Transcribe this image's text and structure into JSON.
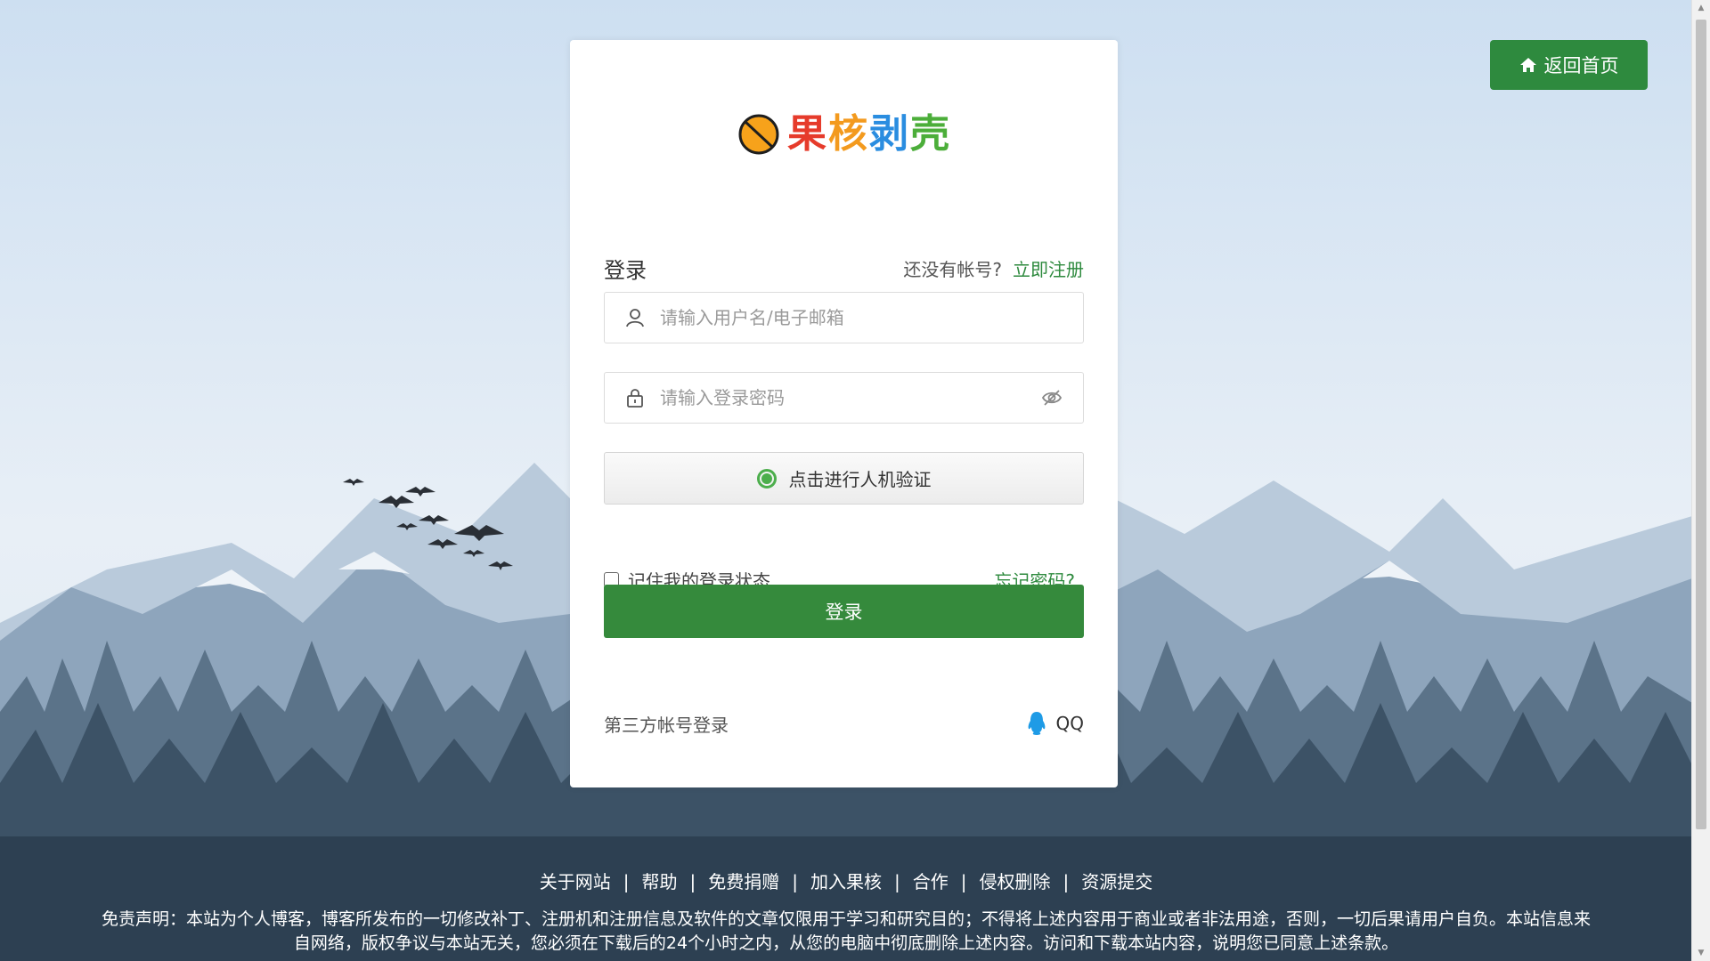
{
  "home_button": {
    "label": "返回首页",
    "icon": "home-icon"
  },
  "logo": {
    "text_chars": [
      "果",
      "核",
      "剥",
      "壳"
    ],
    "mark": "no-sign-logo"
  },
  "login": {
    "title": "登录",
    "no_account_text": "还没有帐号?",
    "register_link": "立即注册",
    "username_placeholder": "请输入用户名/电子邮箱",
    "password_placeholder": "请输入登录密码",
    "captcha_label": "点击进行人机验证",
    "remember_label": "记住我的登录状态",
    "forgot_link": "忘记密码?",
    "submit_label": "登录",
    "third_party_label": "第三方帐号登录",
    "qq_label": "QQ"
  },
  "footer": {
    "links": [
      "关于网站",
      "帮助",
      "免费捐赠",
      "加入果核",
      "合作",
      "侵权删除",
      "资源提交"
    ],
    "separator": "|",
    "disclaimer_line1": "免责声明：本站为个人博客，博客所发布的一切修改补丁、注册机和注册信息及软件的文章仅限用于学习和研究目的；不得将上述内容用于商业或者非法用途，否则，一切后果请用户自负。本站信息来",
    "disclaimer_line2": "自网络，版权争议与本站无关，您必须在下载后的24个小时之内，从您的电脑中彻底删除上述内容。访问和下载本站内容，说明您已同意上述条款。"
  },
  "colors": {
    "accent": "#2e8a3e",
    "submit": "#358a3c"
  }
}
